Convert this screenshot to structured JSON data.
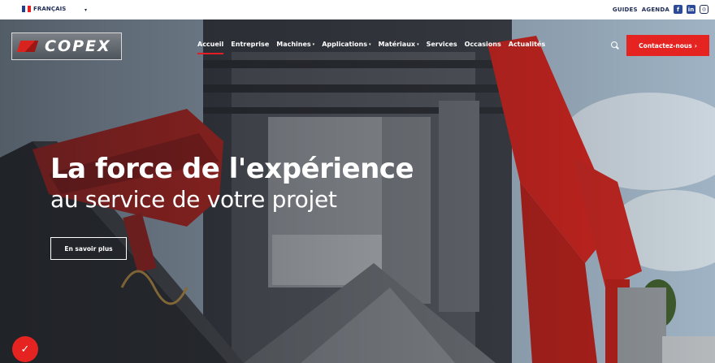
{
  "topbar": {
    "language": "FRANÇAIS",
    "language_chevron": "▾",
    "links": [
      "GUIDES",
      "AGENDA"
    ],
    "social_icons": [
      "facebook-icon",
      "linkedin-icon",
      "instagram-icon"
    ],
    "social_glyphs": [
      "f",
      "in",
      "◎"
    ]
  },
  "header": {
    "logo_text": "COPEX",
    "nav": [
      {
        "label": "Accueil",
        "dropdown": false,
        "active": true
      },
      {
        "label": "Entreprise",
        "dropdown": false
      },
      {
        "label": "Machines",
        "dropdown": true
      },
      {
        "label": "Applications",
        "dropdown": true
      },
      {
        "label": "Matériaux",
        "dropdown": true
      },
      {
        "label": "Services",
        "dropdown": false
      },
      {
        "label": "Occasions",
        "dropdown": false
      },
      {
        "label": "Actualités",
        "dropdown": false
      }
    ],
    "dropdown_caret": "▾",
    "cta_label": "Contactez-nous",
    "cta_arrow": "›"
  },
  "hero": {
    "title_line1": "La force de l'expérience",
    "title_line2": "au service de votre projet",
    "button_label": "En savoir plus"
  },
  "colors": {
    "accent": "#e52421",
    "text_dark": "#1f2b55"
  }
}
